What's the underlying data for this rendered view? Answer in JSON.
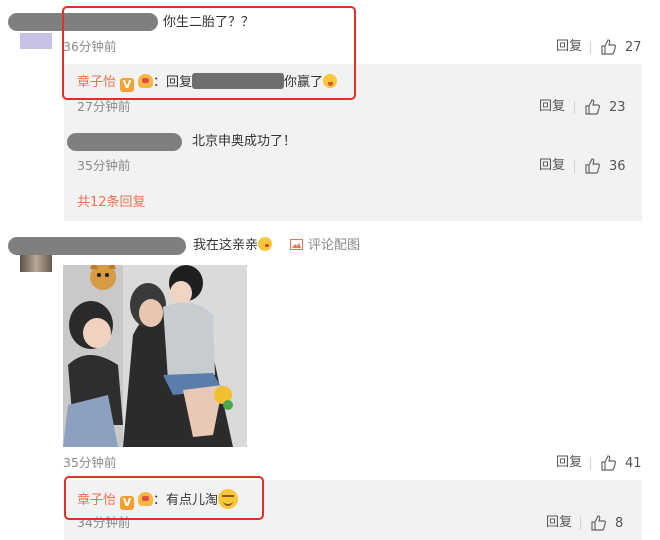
{
  "comment1": {
    "text": "你生二胎了？？",
    "time": "36分钟前",
    "reply_label": "回复",
    "likes": "27"
  },
  "reply1": {
    "author": "章子怡",
    "sep": "：",
    "text_prefix": "回复",
    "text_suffix": "你赢了",
    "time": "27分钟前",
    "reply_label": "回复",
    "likes": "23"
  },
  "reply2": {
    "text": "北京申奥成功了！",
    "time": "35分钟前",
    "reply_label": "回复",
    "likes": "36"
  },
  "more_replies": "共12条回复",
  "comment2": {
    "text": "我在这亲亲",
    "image_link": "评论配图",
    "time": "35分钟前",
    "reply_label": "回复",
    "likes": "41"
  },
  "reply3": {
    "author": "章子怡",
    "sep": "：",
    "text": "有点儿淘",
    "time": "34分钟前",
    "reply_label": "回复",
    "likes": "8"
  },
  "colors": {
    "accent": "#eb7350",
    "highlight_box": "#e0302a",
    "panel_bg": "#f2f2f2"
  }
}
